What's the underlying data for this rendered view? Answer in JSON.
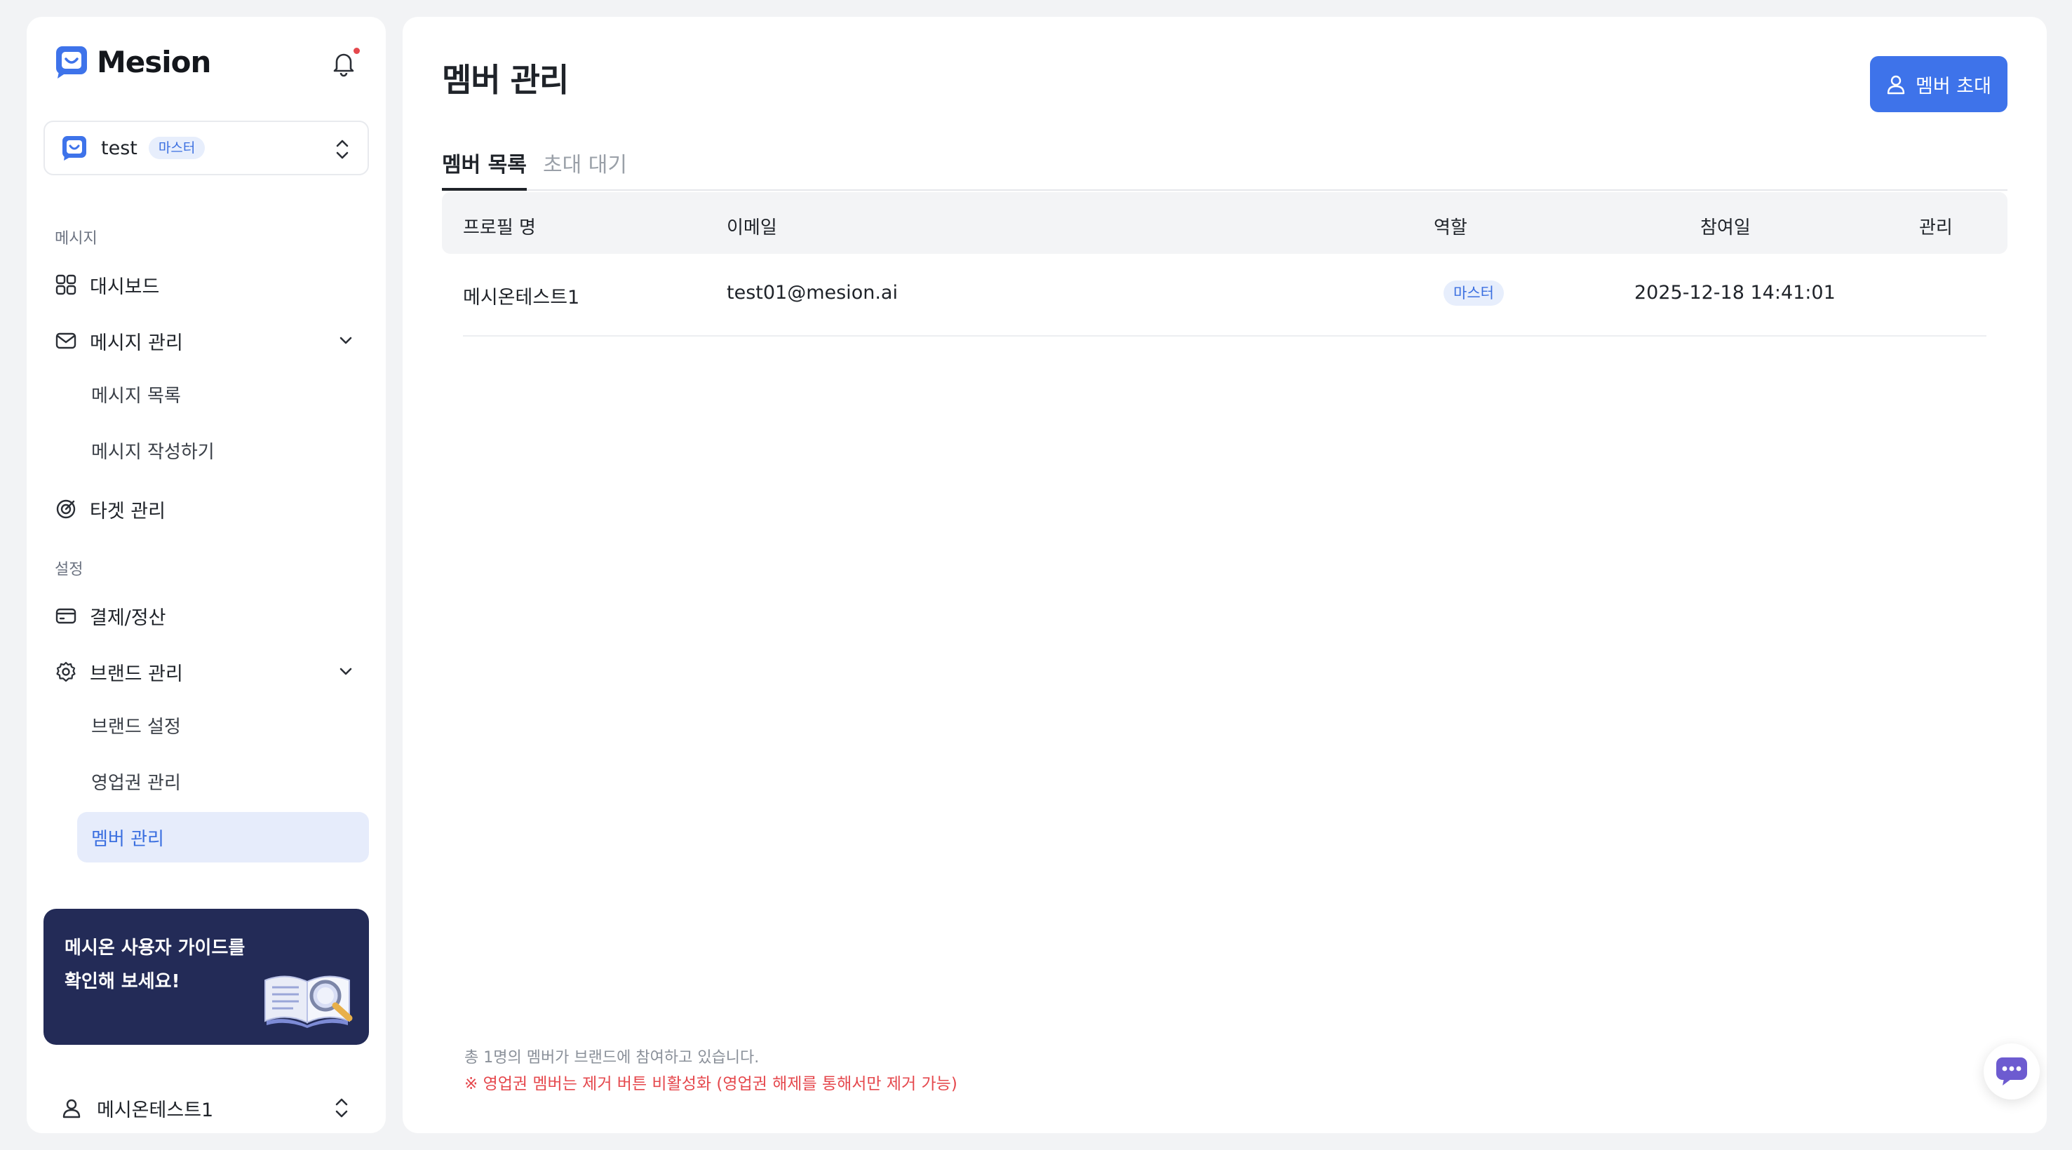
{
  "brand": {
    "name": "Mesion"
  },
  "workspace": {
    "name": "test",
    "role_badge": "마스터"
  },
  "sidebar": {
    "section_message": "메시지",
    "dashboard": "대시보드",
    "message_management": "메시지 관리",
    "message_list": "메시지 목록",
    "message_compose": "메시지 작성하기",
    "target_management": "타겟 관리",
    "section_settings": "설정",
    "billing": "결제/정산",
    "brand_management": "브랜드 관리",
    "brand_settings": "브랜드 설정",
    "sales_territory": "영업권 관리",
    "member_management": "멤버 관리"
  },
  "guide_banner": {
    "line1": "메시온 사용자 가이드를",
    "line2": "확인해 보세요!"
  },
  "user": {
    "name": "메시온테스트1"
  },
  "page": {
    "title": "멤버 관리",
    "invite_button": "멤버 초대"
  },
  "tabs": {
    "members": "멤버 목록",
    "pending": "초대 대기"
  },
  "table": {
    "headers": {
      "profile": "프로필 명",
      "email": "이메일",
      "role": "역할",
      "joined": "참여일",
      "manage": "관리"
    },
    "rows": [
      {
        "profile": "메시온테스트1",
        "email": "test01@mesion.ai",
        "role": "마스터",
        "joined": "2025-12-18 14:41:01"
      }
    ]
  },
  "footer": {
    "summary": "총 1명의 멤버가 브랜드에 참여하고 있습니다.",
    "warning": "※ 영업권 멤버는 제거 버튼 비활성화 (영업권 해제를 통해서만 제거 가능)"
  },
  "colors": {
    "accent": "#3e73ea",
    "banner": "#232b57",
    "warning": "#e5484d",
    "active_bg": "#e6ecfb"
  }
}
